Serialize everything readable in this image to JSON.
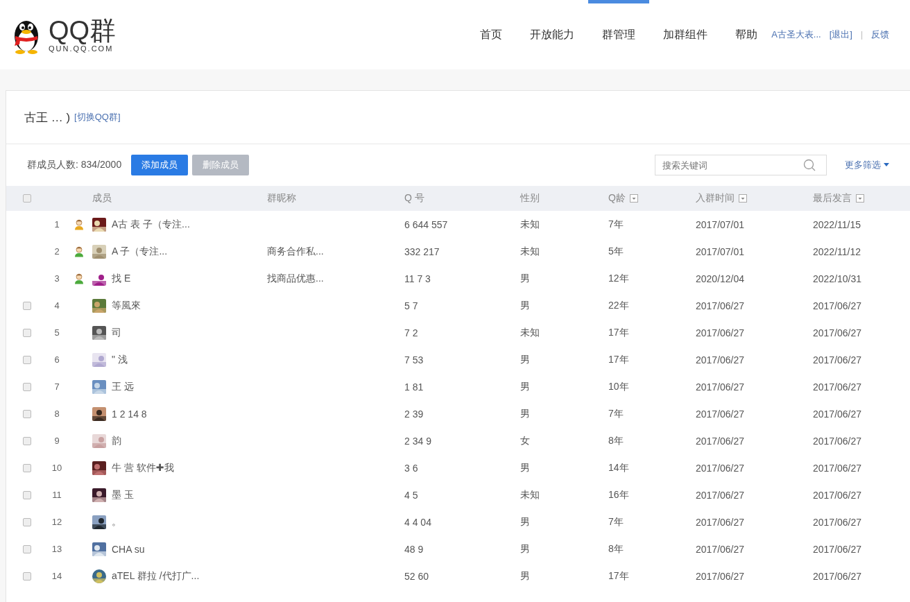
{
  "logo": {
    "title": "QQ群",
    "subtitle": "QUN.QQ.COM"
  },
  "nav": [
    {
      "label": "首页",
      "selected": false
    },
    {
      "label": "开放能力",
      "selected": false
    },
    {
      "label": "群管理",
      "selected": true
    },
    {
      "label": "加群组件",
      "selected": false
    },
    {
      "label": "帮助",
      "selected": false
    }
  ],
  "user": {
    "name": "A古圣大表...",
    "logout": "[退出]",
    "separator": "|",
    "feedback": "反馈"
  },
  "group": {
    "title": "古王 … )",
    "switch_link": "[切换QQ群]"
  },
  "toolbar": {
    "member_count": "群成员人数: 834/2000",
    "add_button": "添加成员",
    "delete_button": {
      "label": "删除成员",
      "disabled": true
    },
    "search": {
      "placeholder": "搜索关键词"
    },
    "more_filters": "更多筛选"
  },
  "table": {
    "select_all": {
      "checked": false
    },
    "columns": [
      {
        "label": "成员",
        "filter": false
      },
      {
        "label": "群昵称",
        "filter": false
      },
      {
        "label": "Q 号",
        "filter": false
      },
      {
        "label": "性别",
        "filter": false
      },
      {
        "label": "Q龄",
        "filter": true
      },
      {
        "label": "入群时间",
        "filter": true
      },
      {
        "label": "最后发言",
        "filter": true
      }
    ],
    "rows": [
      {
        "index": "1",
        "kind": "owner",
        "name": "A古  表 子（专注...",
        "qq": "6  644 557",
        "gender": "未知",
        "q_age": "7年",
        "joined": "2017/07/01",
        "last_spoke": "2022/11/15"
      },
      {
        "index": "2",
        "kind": "admin",
        "name": "A  子（专注...",
        "nickname": "商务合作私...",
        "qq": "332 217",
        "gender": "未知",
        "q_age": "5年",
        "joined": "2017/07/01",
        "last_spoke": "2022/11/12"
      },
      {
        "index": "3",
        "kind": "admin",
        "name": "找  E",
        "nickname": "找商品优惠...",
        "qq": "11 7 3",
        "gender": "男",
        "q_age": "12年",
        "joined": "2020/12/04",
        "last_spoke": "2022/10/31"
      },
      {
        "index": "4",
        "kind": "member",
        "checked": false,
        "name": "等風來",
        "qq": "5 7",
        "gender": "男",
        "q_age": "22年",
        "joined": "2017/06/27",
        "last_spoke": "2017/06/27"
      },
      {
        "index": "5",
        "kind": "member",
        "checked": false,
        "name": "司",
        "qq": "7  2",
        "gender": "未知",
        "q_age": "17年",
        "joined": "2017/06/27",
        "last_spoke": "2017/06/27"
      },
      {
        "index": "6",
        "kind": "member",
        "checked": false,
        "name": "\" 浅 ",
        "qq": "7  53",
        "gender": "男",
        "q_age": "17年",
        "joined": "2017/06/27",
        "last_spoke": "2017/06/27"
      },
      {
        "index": "7",
        "kind": "member",
        "checked": false,
        "name": "王 远",
        "qq": "1  81",
        "gender": "男",
        "q_age": "10年",
        "joined": "2017/06/27",
        "last_spoke": "2017/06/27"
      },
      {
        "index": "8",
        "kind": "member",
        "checked": false,
        "name": "1 2  14 8",
        "qq": "2  39",
        "gender": "男",
        "q_age": "7年",
        "joined": "2017/06/27",
        "last_spoke": "2017/06/27"
      },
      {
        "index": "9",
        "kind": "member",
        "checked": false,
        "name": "韵",
        "qq": "2  34 9",
        "gender": "女",
        "q_age": "8年",
        "joined": "2017/06/27",
        "last_spoke": "2017/06/27"
      },
      {
        "index": "10",
        "kind": "member",
        "checked": false,
        "name": "牛  营 软件✚我",
        "qq": "3  6",
        "gender": "男",
        "q_age": "14年",
        "joined": "2017/06/27",
        "last_spoke": "2017/06/27"
      },
      {
        "index": "11",
        "kind": "member",
        "checked": false,
        "name": "墨 玉",
        "qq": "4  5",
        "gender": "未知",
        "q_age": "16年",
        "joined": "2017/06/27",
        "last_spoke": "2017/06/27"
      },
      {
        "index": "12",
        "kind": "member",
        "checked": false,
        "name": "。",
        "qq": "4 4 04",
        "gender": "男",
        "q_age": "7年",
        "joined": "2017/06/27",
        "last_spoke": "2017/06/27"
      },
      {
        "index": "13",
        "kind": "member",
        "checked": false,
        "name": "CHA  su",
        "qq": "48  9",
        "gender": "男",
        "q_age": "8年",
        "joined": "2017/06/27",
        "last_spoke": "2017/06/27"
      },
      {
        "index": "14",
        "kind": "member",
        "checked": false,
        "name": "aTEL 群拉 /代打广...",
        "qq": "52  60",
        "gender": "男",
        "q_age": "17年",
        "joined": "2017/06/27",
        "last_spoke": "2017/06/27"
      }
    ]
  }
}
